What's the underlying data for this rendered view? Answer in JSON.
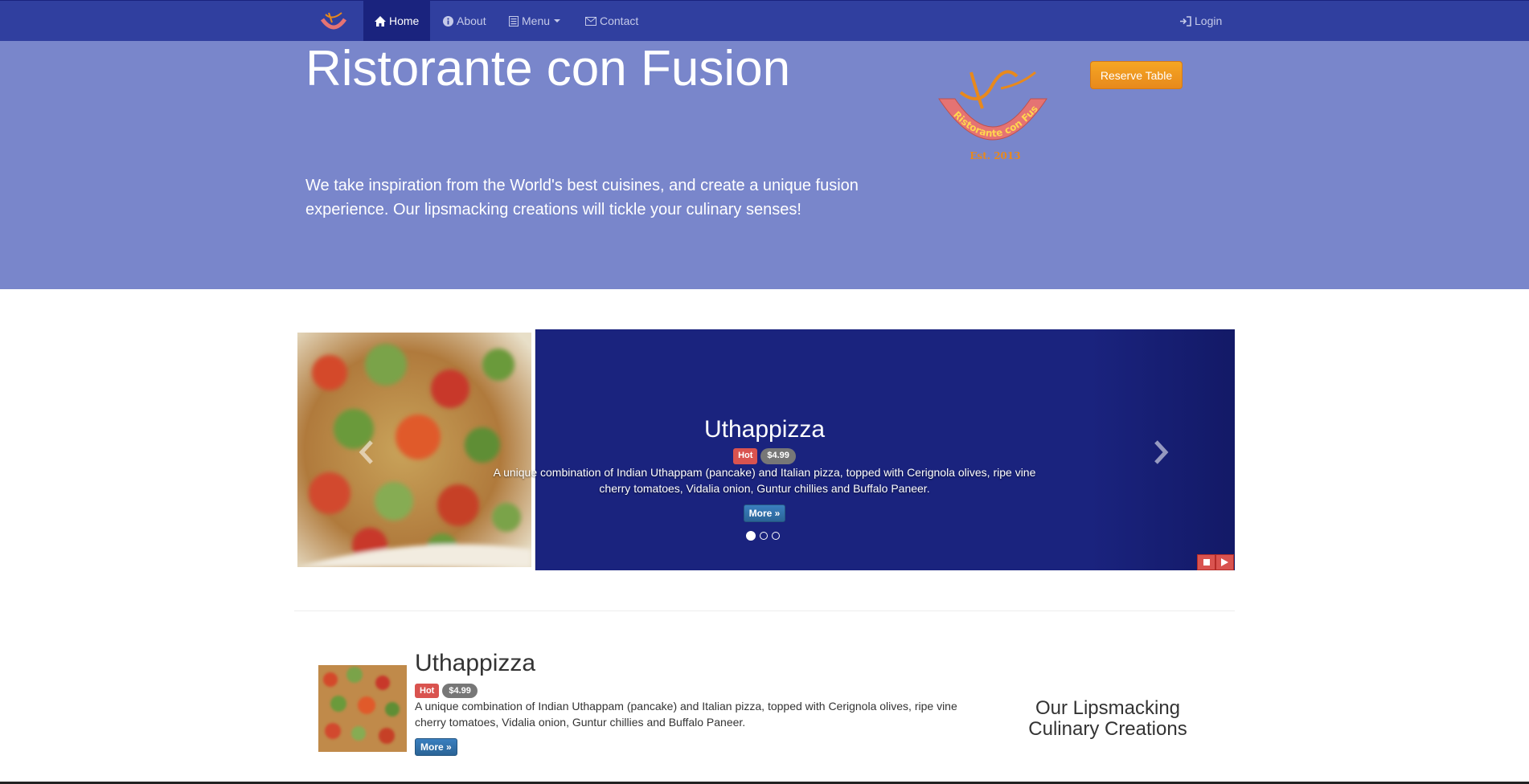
{
  "navbar": {
    "brand_logo": "restaurant-logo",
    "items": [
      {
        "label": "Home",
        "icon": "home-icon",
        "active": true
      },
      {
        "label": "About",
        "icon": "info-icon"
      },
      {
        "label": "Menu",
        "icon": "list-icon"
      },
      {
        "label": "Contact",
        "icon": "envelope-icon"
      }
    ],
    "login": {
      "label": "Login",
      "icon": "login-icon"
    }
  },
  "jumbotron": {
    "title": "Ristorante con Fusion",
    "text": "We take inspiration from the World's best cuisines, and create a unique fusion experience. Our lipsmacking creations will tickle your culinary senses!",
    "logo_text": "Ristorante con Fusion",
    "logo_est": "Est. 2013",
    "reserve_label": "Reserve Table"
  },
  "carousel": {
    "title": "Uthappizza",
    "badge": "Hot",
    "price": "$4.99",
    "description": "A unique combination of Indian Uthappam (pancake) and Italian pizza, topped with Cerignola olives, ripe vine cherry tomatoes, Vidalia onion, Guntur chillies and Buffalo Paneer.",
    "more_label": "More »",
    "slide_count": 3,
    "active_index": 0
  },
  "featured": {
    "title": "Uthappizza",
    "badge": "Hot",
    "price": "$4.99",
    "description": "A unique combination of Indian Uthappam (pancake) and Italian pizza, topped with Cerignola olives, ripe vine cherry tomatoes, Vidalia onion, Guntur chillies and Buffalo Paneer.",
    "more_label": "More »"
  },
  "section_heading": "Our Lipsmacking Culinary Creations",
  "colors": {
    "navbar": "#303f9f",
    "navbar_active": "#1a237e",
    "jumbotron": "#7986cb",
    "carousel": "#1a237e",
    "reserve": "#f0a030",
    "hot_badge": "#d9534f"
  }
}
